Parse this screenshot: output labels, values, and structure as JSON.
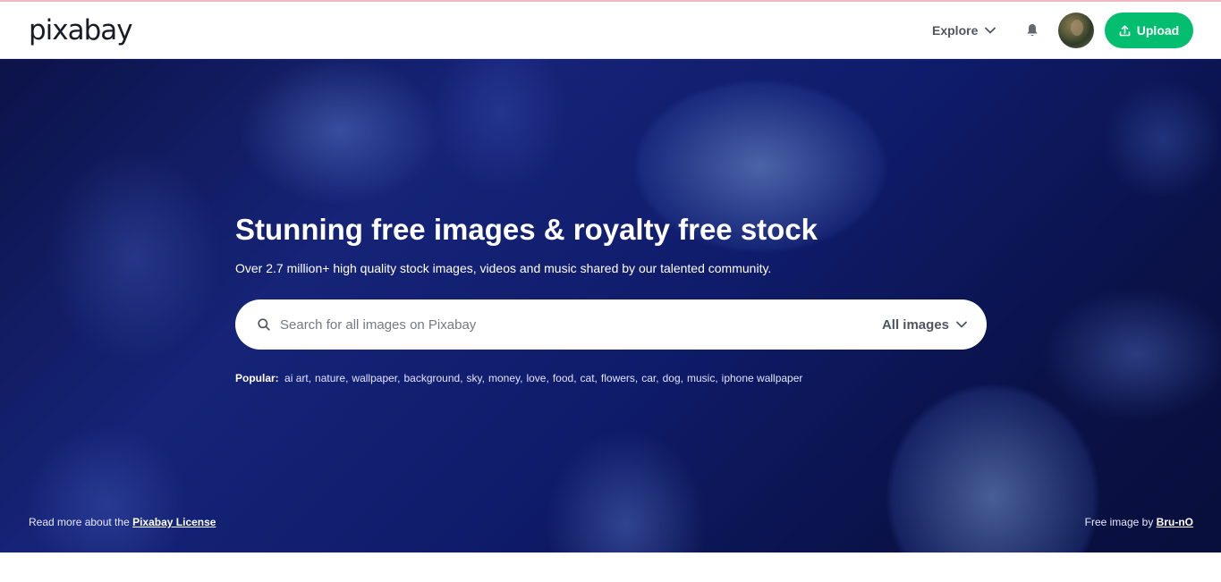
{
  "header": {
    "logo_text": "pixabay",
    "explore_label": "Explore",
    "upload_label": "Upload",
    "accent_color": "#02be6e"
  },
  "hero": {
    "title": "Stunning free images & royalty free stock",
    "subtitle": "Over 2.7 million+ high quality stock images, videos and music shared by our talented community.",
    "search": {
      "placeholder": "Search for all images on Pixabay",
      "value": "",
      "type_label": "All images"
    },
    "popular_label": "Popular:",
    "popular_tags": [
      "ai art",
      "nature",
      "wallpaper",
      "background",
      "sky",
      "money",
      "love",
      "food",
      "cat",
      "flowers",
      "car",
      "dog",
      "music",
      "iphone wallpaper"
    ],
    "license_prefix": "Read more about the ",
    "license_link": "Pixabay License",
    "credit_prefix": "Free image by ",
    "credit_author": "Bru-nO"
  },
  "icons": {
    "explore": "chevron-down-icon",
    "notifications": "bell-icon",
    "upload": "upload-icon",
    "search": "search-icon",
    "type_select": "chevron-down-icon"
  }
}
